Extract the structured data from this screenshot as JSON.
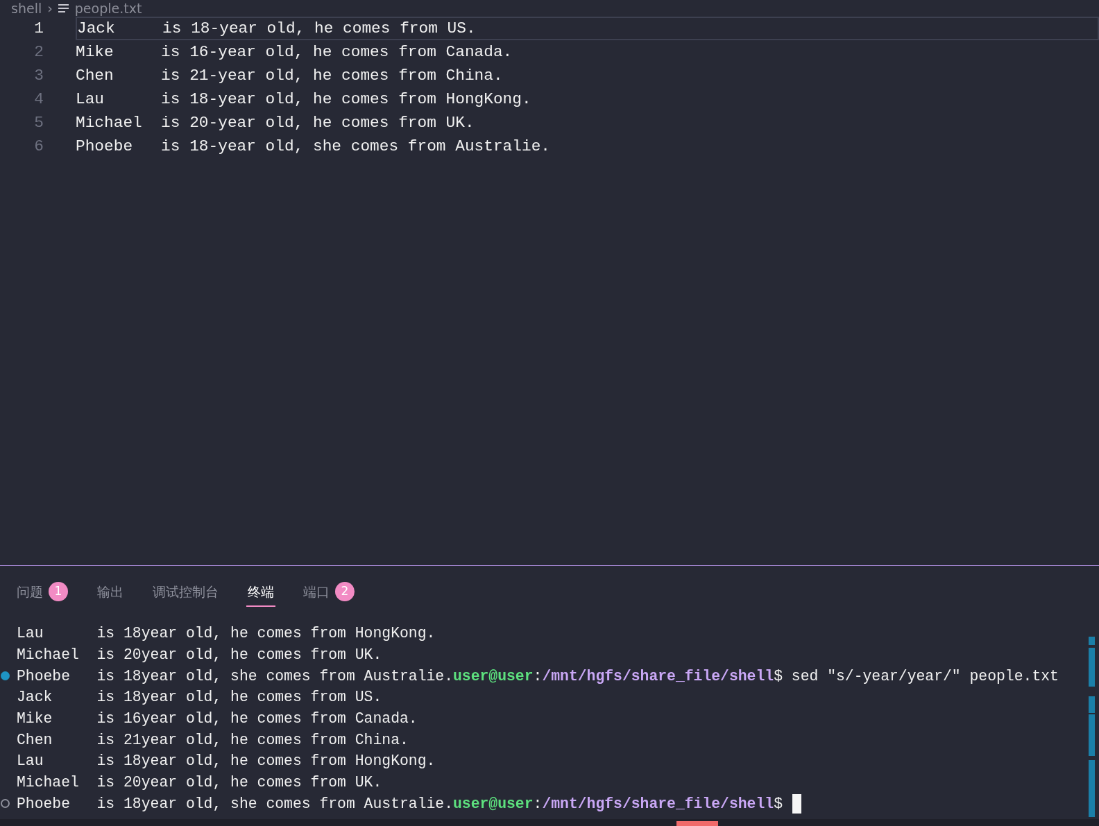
{
  "breadcrumb": {
    "folder": "shell",
    "separator": "›",
    "file": "people.txt"
  },
  "editor": {
    "lines": [
      {
        "number": "1",
        "text": "Jack     is 18-year old, he comes from US.",
        "current": true
      },
      {
        "number": "2",
        "text": "Mike     is 16-year old, he comes from Canada.",
        "current": false
      },
      {
        "number": "3",
        "text": "Chen     is 21-year old, he comes from China.",
        "current": false
      },
      {
        "number": "4",
        "text": "Lau      is 18-year old, he comes from HongKong.",
        "current": false
      },
      {
        "number": "5",
        "text": "Michael  is 20-year old, he comes from UK.",
        "current": false
      },
      {
        "number": "6",
        "text": "Phoebe   is 18-year old, she comes from Australie.",
        "current": false
      }
    ]
  },
  "panel": {
    "tabs": [
      {
        "label": "问题",
        "badge": "1",
        "selected": false
      },
      {
        "label": "输出",
        "selected": false
      },
      {
        "label": "调试控制台",
        "selected": false
      },
      {
        "label": "终端",
        "selected": true
      },
      {
        "label": "端口",
        "badge": "2",
        "selected": false
      }
    ]
  },
  "terminal": {
    "lines": [
      {
        "text": "Lau      is 18year old, he comes from HongKong."
      },
      {
        "text": "Michael  is 20year old, he comes from UK."
      },
      {
        "text": "Phoebe   is 18year old, she comes from Australie.",
        "finished": true,
        "prompt": {
          "user": "user@user",
          "colon": ":",
          "path": "/mnt/hgfs/share_file/shell",
          "dollar": "$",
          "command": " sed \"s/-year/year/\" people.txt"
        }
      },
      {
        "text": "Jack     is 18year old, he comes from US."
      },
      {
        "text": "Mike     is 16year old, he comes from Canada."
      },
      {
        "text": "Chen     is 21year old, he comes from China."
      },
      {
        "text": "Lau      is 18year old, he comes from HongKong."
      },
      {
        "text": "Michael  is 20year old, he comes from UK."
      },
      {
        "text": "Phoebe   is 18year old, she comes from Australie.",
        "finished": false,
        "prompt": {
          "user": "user@user",
          "colon": ":",
          "path": "/mnt/hgfs/share_file/shell",
          "dollar": "$"
        },
        "cursor": true
      }
    ]
  }
}
